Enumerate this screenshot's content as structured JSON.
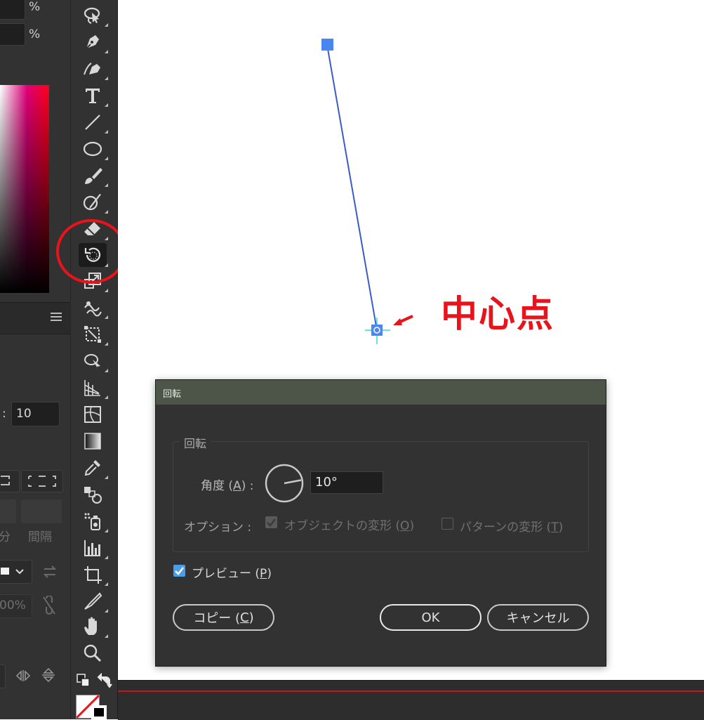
{
  "left_panel": {
    "percent_1": "%",
    "percent_2": "%",
    "field_value": "10",
    "field_colon": ":",
    "label_bun": "分",
    "label_kankaku": "間隔",
    "opacity_value": "00%"
  },
  "canvas": {
    "annotation": "中心点"
  },
  "dialog": {
    "title": "回転",
    "group_label": "回転",
    "angle_label": "角度 (",
    "angle_key": "A",
    "angle_label_end": ") :",
    "angle_value": "10°",
    "options_label": "オプション :",
    "option_object_label": "オブジェクトの変形 (",
    "option_object_key": "O",
    "option_object_end": ")",
    "option_pattern_label": "パターンの変形 (",
    "option_pattern_key": "T",
    "option_pattern_end": ")",
    "preview_label": "プレビュー (",
    "preview_key": "P",
    "preview_end": ")",
    "copy_label": "コピー (",
    "copy_key": "C",
    "copy_end": ")",
    "ok_label": "OK",
    "cancel_label": "キャンセル"
  },
  "colors": {
    "accent_blue": "#4a86f0",
    "highlight_red": "#e8131b"
  }
}
